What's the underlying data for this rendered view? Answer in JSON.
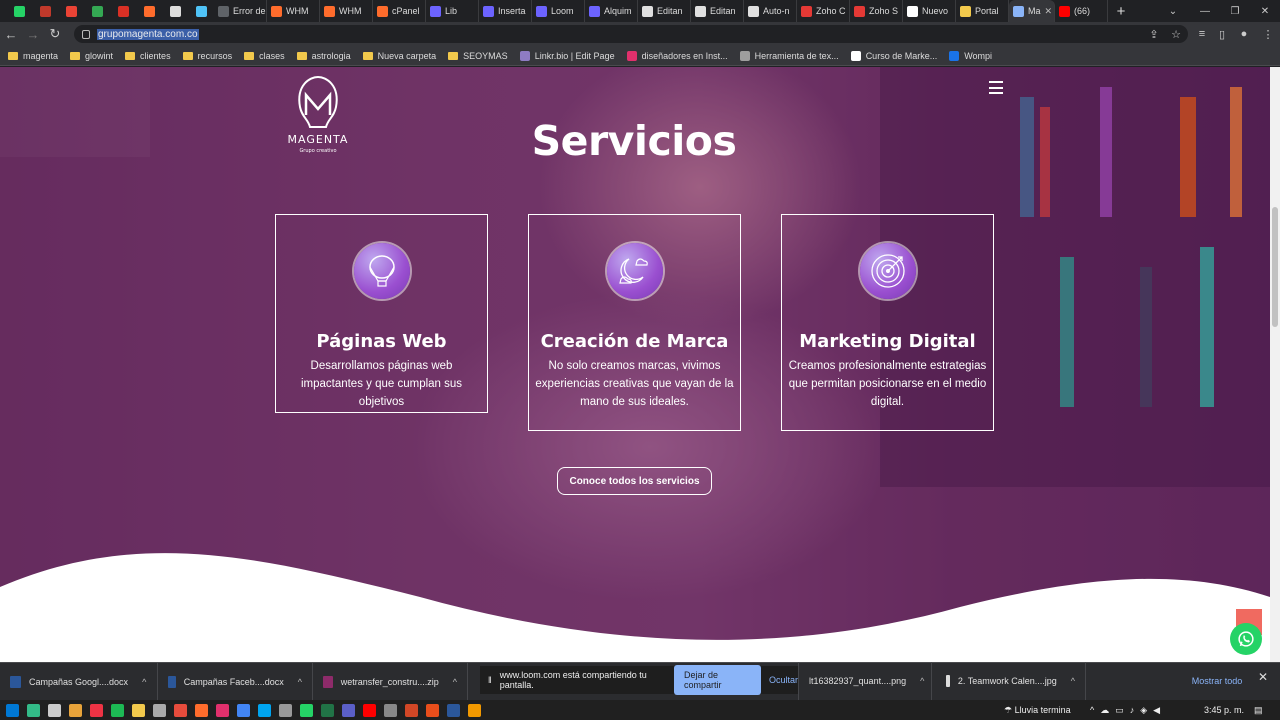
{
  "browser": {
    "tabs": [
      {
        "label": "",
        "color": "#25d366",
        "pinned": true
      },
      {
        "label": "",
        "color": "#c0392b",
        "pinned": true
      },
      {
        "label": "",
        "color": "#ea4335",
        "pinned": true
      },
      {
        "label": "",
        "color": "#34a853",
        "pinned": true
      },
      {
        "label": "",
        "color": "#d93025",
        "pinned": true
      },
      {
        "label": "",
        "color": "#ff6c2c",
        "pinned": true
      },
      {
        "label": "",
        "color": "#dddddd",
        "pinned": true
      },
      {
        "label": "",
        "color": "#4fc3f7",
        "pinned": true
      },
      {
        "label": "Error de pr",
        "color": "#5f6368"
      },
      {
        "label": "WHM",
        "color": "#ff6c2c"
      },
      {
        "label": "WHM",
        "color": "#ff6c2c"
      },
      {
        "label": "cPanel",
        "color": "#ff6c2c"
      },
      {
        "label": "Lib",
        "color": "#6c63ff"
      },
      {
        "label": "Inserta",
        "color": "#6c63ff"
      },
      {
        "label": "Loom",
        "color": "#6c63ff"
      },
      {
        "label": "Alquim",
        "color": "#6c63ff"
      },
      {
        "label": "Editan",
        "color": "#e0e0e0"
      },
      {
        "label": "Editan",
        "color": "#e0e0e0"
      },
      {
        "label": "Auto-n",
        "color": "#e0e0e0"
      },
      {
        "label": "Zoho C",
        "color": "#e53935"
      },
      {
        "label": "Zoho S",
        "color": "#e53935"
      },
      {
        "label": "Nuevo",
        "color": "#ffffff"
      },
      {
        "label": "Portal",
        "color": "#f2c94c"
      },
      {
        "label": "Ma",
        "color": "#8ab4f8",
        "active": true
      },
      {
        "label": "(66)",
        "color": "#ff0000"
      }
    ],
    "url": "grupomagenta.com.co",
    "bookmarks": [
      {
        "label": "magenta",
        "type": "folder"
      },
      {
        "label": "glowint",
        "type": "folder"
      },
      {
        "label": "clientes",
        "type": "folder"
      },
      {
        "label": "recursos",
        "type": "folder"
      },
      {
        "label": "clases",
        "type": "folder"
      },
      {
        "label": "astrologia",
        "type": "folder"
      },
      {
        "label": "Nueva carpeta",
        "type": "folder"
      },
      {
        "label": "SEOYMAS",
        "type": "folder"
      },
      {
        "label": "Linkr.bio | Edit Page",
        "type": "site",
        "color": "#8e7cc3"
      },
      {
        "label": "diseñadores en Inst...",
        "type": "site",
        "color": "#e1306c"
      },
      {
        "label": "Herramienta de tex...",
        "type": "site",
        "color": "#9e9e9e"
      },
      {
        "label": "Curso de Marke...",
        "type": "site",
        "color": "#ffffff"
      },
      {
        "label": "Wompi",
        "type": "site",
        "color": "#1a73e8"
      }
    ]
  },
  "page": {
    "logo_text": "MAGENTA",
    "logo_sub": "Grupo creativo",
    "title": "Servicios",
    "services": [
      {
        "title": "Páginas Web",
        "desc": "Desarrollamos páginas web impactantes y que cumplan sus objetivos",
        "icon": "hot-air-balloon-icon"
      },
      {
        "title": "Creación de Marca",
        "desc": "No solo creamos marcas, vivimos experiencias creativas que vayan de la mano de sus ideales.",
        "icon": "moon-clouds-icon"
      },
      {
        "title": "Marketing Digital",
        "desc": "Creamos profesionalmente estrategias que permitan posicionarse en el medio digital.",
        "icon": "target-icon"
      }
    ],
    "cta": "Conoce todos los servicios"
  },
  "downloads": {
    "items": [
      "Campañas Googl....docx",
      "Campañas Faceb....docx",
      "wetransfer_constru....zip",
      "lt16382937_quant....png",
      "2. Teamwork Calen....jpg"
    ],
    "share_text": "www.loom.com está compartiendo tu pantalla.",
    "stop_share": "Dejar de compartir",
    "hide": "Ocultar",
    "show_all": "Mostrar todo"
  },
  "taskbar": {
    "weather": "Lluvia termina",
    "time": "3:45 p. m."
  },
  "colors": {
    "accent": "#8ab4f8",
    "whatsapp": "#25d366",
    "totop": "#f06a60"
  }
}
